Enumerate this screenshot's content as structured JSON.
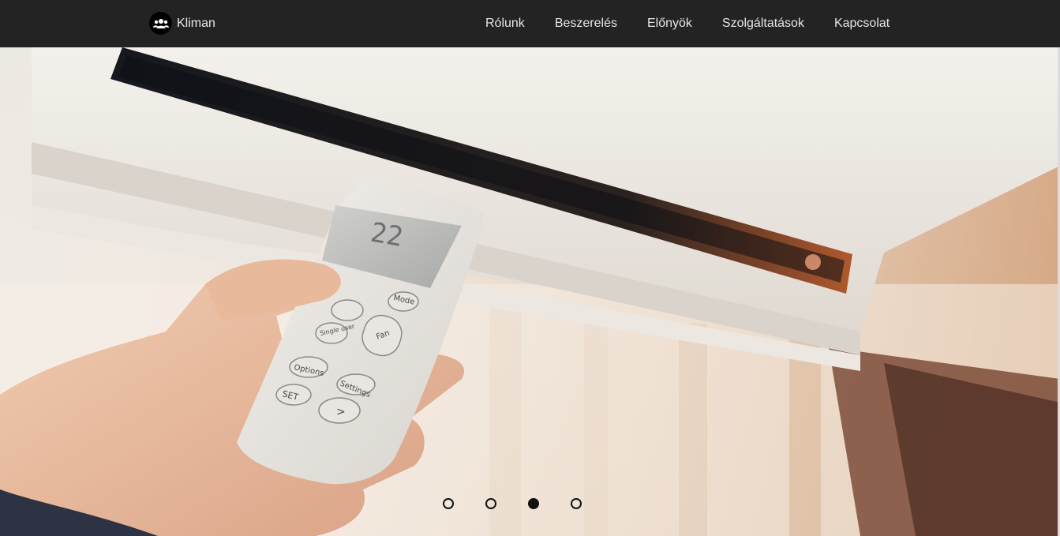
{
  "brand": {
    "name": "Kliman",
    "icon": "users-icon"
  },
  "nav": {
    "items": [
      {
        "label": "Rólunk"
      },
      {
        "label": "Beszerelés"
      },
      {
        "label": "Előnyök"
      },
      {
        "label": "Szolgáltatások"
      },
      {
        "label": "Kapcsolat"
      }
    ]
  },
  "hero": {
    "image": "air-conditioner-remote-photo",
    "remote": {
      "display": "22",
      "buttons": [
        "Mode",
        "Single user",
        "Fan",
        "Options",
        "Settings",
        "SET",
        ">"
      ]
    }
  },
  "carousel": {
    "slide_count": 4,
    "active_index": 2
  },
  "colors": {
    "navbar_bg": "#232323",
    "nav_text": "#e6e6e6",
    "dot": "#111111"
  }
}
